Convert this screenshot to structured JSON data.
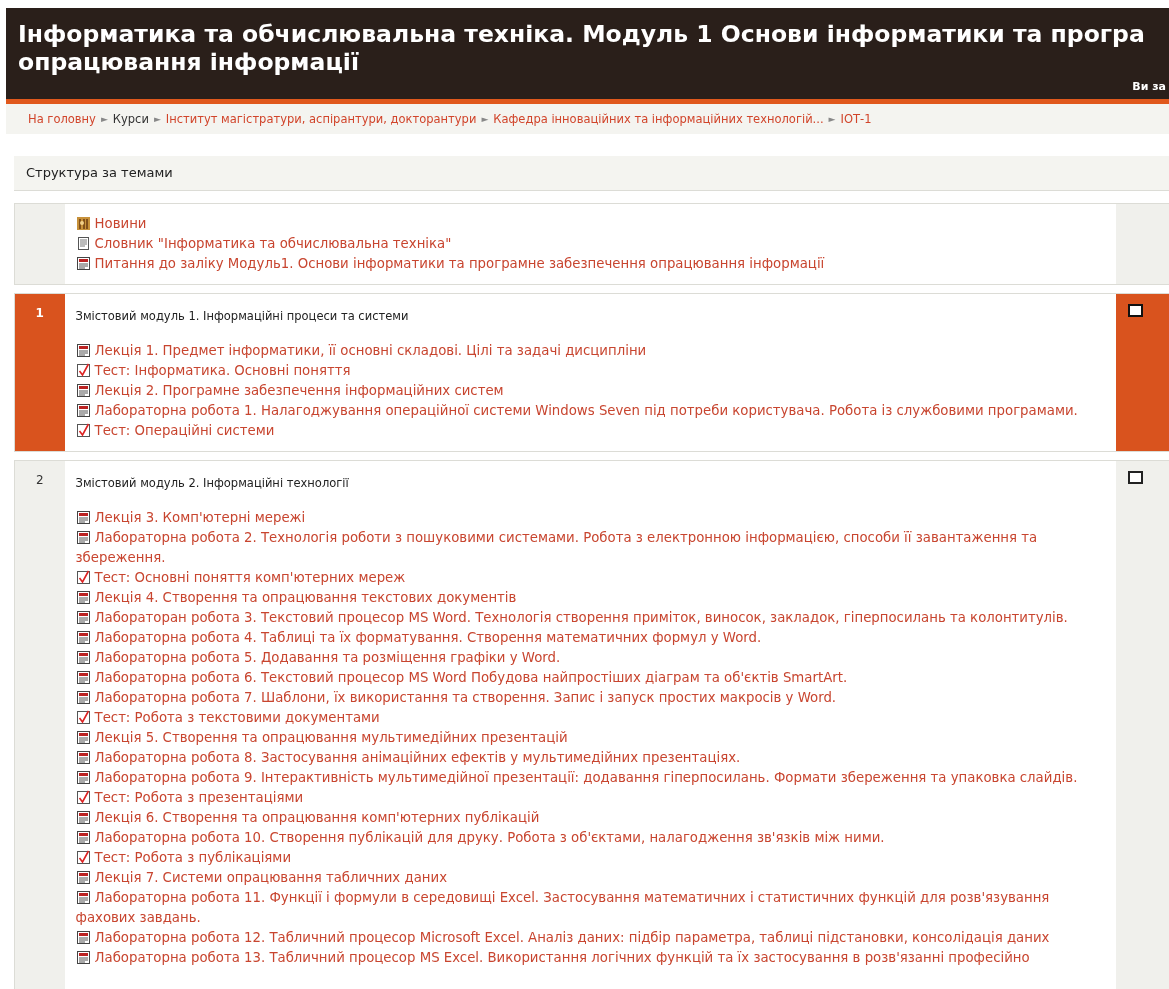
{
  "header": {
    "title_lines": [
      "Інформатика та обчислювальна техніка. Модуль 1 Основи інформатики та програ",
      "опрацювання інформації"
    ],
    "login_info": "Ви за"
  },
  "breadcrumb": {
    "separator": "►",
    "items": [
      {
        "label": "На головну",
        "kind": "link"
      },
      {
        "label": "Курси",
        "kind": "text"
      },
      {
        "label": "Інститут магістратури, аспірантури, докторантури",
        "kind": "link"
      },
      {
        "label": "Кафедра інноваційних та інформаційних технологій...",
        "kind": "link"
      },
      {
        "label": "ІОТ-1",
        "kind": "link"
      }
    ]
  },
  "course_heading": "Структура за темами",
  "sections": [
    {
      "current": false,
      "items": [
        {
          "kind": "forum",
          "label": "Новини"
        },
        {
          "kind": "glossary",
          "label": "Словник \"Інформатика та обчислювальна техніка\""
        },
        {
          "kind": "pdf",
          "label": "Питання до заліку Модуль1. Основи інформатики та програмне забезпечення опрацювання інформації"
        }
      ]
    },
    {
      "number": "1",
      "title": "Змістовий модуль 1.  Інформаційні процеси та системи",
      "current": true,
      "items": [
        {
          "kind": "pdf",
          "label": "Лекція 1. Предмет інформатики, її основні складові. Цілі та задачі дисципліни"
        },
        {
          "kind": "quiz",
          "label": "Тест: Інформатика. Основні поняття"
        },
        {
          "kind": "pdf",
          "label": "Лекція 2. Програмне забезпечення інформаційних систем"
        },
        {
          "kind": "pdf",
          "label": "Лабораторна робота 1. Налагоджування операційної системи Windows Seven під потреби користувача. Робота із службовими програмами."
        },
        {
          "kind": "quiz",
          "label": "Тест: Операційні системи"
        }
      ]
    },
    {
      "number": "2",
      "title": "Змістовий модуль 2. Інформаційні технології",
      "current": false,
      "items": [
        {
          "kind": "pdf",
          "label": "Лекція 3. Комп'ютерні мережі"
        },
        {
          "kind": "pdf",
          "label": "Лабораторна робота 2. Технологія роботи з пошуковими системами. Робота з електронною інформацією, способи її завантаження та збереження."
        },
        {
          "kind": "quiz",
          "label": "Тест: Основні поняття комп'ютерних мереж"
        },
        {
          "kind": "pdf",
          "label": "Лекція 4. Створення та опрацювання текстових документів"
        },
        {
          "kind": "pdf",
          "label": "Лабораторан робота 3. Текстовий процесор MS Word. Технологія створення приміток, виносок, закладок, гіперпосилань та колонтитулів."
        },
        {
          "kind": "pdf",
          "label": "Лабораторна робота 4. Таблиці та їх форматування. Створення математичних формул у Word."
        },
        {
          "kind": "pdf",
          "label": "Лабораторна робота 5. Додавання та розміщення графіки у Word."
        },
        {
          "kind": "pdf",
          "label": "Лабораторна робота 6. Текстовий процесор MS Word Побудова найпростіших діаграм та об'єктів SmartArt."
        },
        {
          "kind": "pdf",
          "label": "Лабораторна робота 7. Шаблони, їх використання та створення. Запис і запуск простих макросів у Word."
        },
        {
          "kind": "quiz",
          "label": "Тест: Робота з текстовими документами"
        },
        {
          "kind": "pdf",
          "label": "Лекція 5. Створення та опрацювання мультимедійних презентацій"
        },
        {
          "kind": "pdf",
          "label": "Лабораторна робота 8. Застосування анімаційних ефектів у мультимедійних презентаціях."
        },
        {
          "kind": "pdf",
          "label": "Лабораторна робота 9. Інтерактивність мультимедійної презентації: додавання гіперпосилань. Формати збереження та упаковка слайдів."
        },
        {
          "kind": "quiz",
          "label": "Тест: Робота з презентаціями"
        },
        {
          "kind": "pdf",
          "label": "Лекція 6. Створення та опрацювання комп'ютерних публікацій"
        },
        {
          "kind": "pdf",
          "label": "Лабораторна робота 10. Створення публікацій для друку. Робота з об'єктами, налагодження зв'язків між ними."
        },
        {
          "kind": "quiz",
          "label": "Тест: Робота з публікаціями"
        },
        {
          "kind": "pdf",
          "label": "Лекція 7. Системи опрацювання табличних даних"
        },
        {
          "kind": "pdf",
          "label": "Лабораторна робота 11. Функції і формули в середовищі Excel. Застосування математичних і статистичних функцій для розв'язування фахових завдань."
        },
        {
          "kind": "pdf",
          "label": "Лабораторна робота 12. Табличний процесор Microsoft Excel. Аналіз даних: підбір параметра, таблиці підстановки, консолідація даних"
        },
        {
          "kind": "pdf",
          "label": "Лабораторна робота 13. Табличний процесор MS Excel. Використання логічних функцій та їх застосування в розв'язанні професійно"
        }
      ]
    }
  ]
}
